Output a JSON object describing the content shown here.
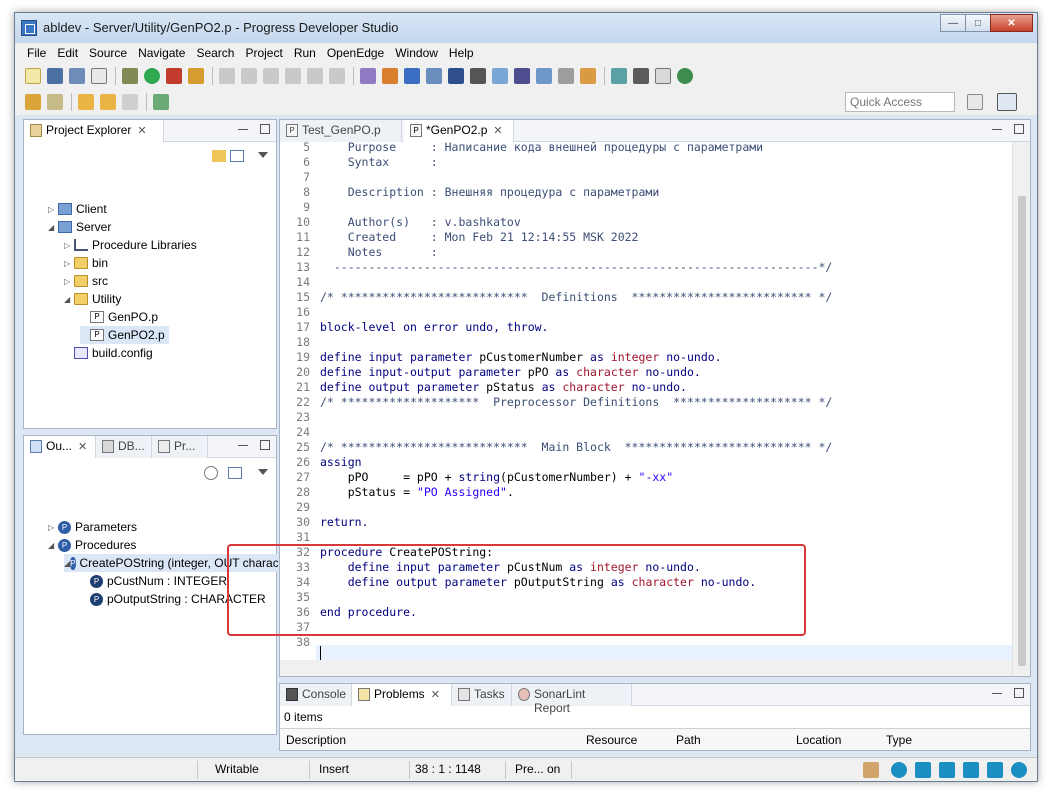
{
  "window": {
    "title": "abldev - Server/Utility/GenPO2.p - Progress Developer Studio"
  },
  "menu": [
    "File",
    "Edit",
    "Source",
    "Navigate",
    "Search",
    "Project",
    "Run",
    "OpenEdge",
    "Window",
    "Help"
  ],
  "toolbar": {
    "quick_access_placeholder": "Quick Access"
  },
  "project_explorer": {
    "title": "Project Explorer",
    "items": [
      {
        "label": "Client"
      },
      {
        "label": "Server"
      },
      {
        "label": "Procedure Libraries"
      },
      {
        "label": "bin"
      },
      {
        "label": "src"
      },
      {
        "label": "Utility"
      },
      {
        "label": "GenPO.p"
      },
      {
        "label": "GenPO2.p"
      },
      {
        "label": "build.config"
      }
    ]
  },
  "outline": {
    "tabs": [
      "Ou...",
      "DB...",
      "Pr..."
    ],
    "items": [
      {
        "label": "Parameters"
      },
      {
        "label": "Procedures"
      },
      {
        "label": "CreatePOString (integer, OUT charac"
      },
      {
        "label": "pCustNum : INTEGER"
      },
      {
        "label": "pOutputString : CHARACTER"
      }
    ]
  },
  "editor": {
    "tabs": [
      {
        "label": "Test_GenPO.p",
        "active": false
      },
      {
        "label": "*GenPO2.p",
        "active": true
      }
    ],
    "lines": [
      {
        "n": "5",
        "text": "    Purpose     : Написание кода внешней процедуры с параметрами",
        "cls": "cm",
        "partial": true
      },
      {
        "n": "6",
        "text": "    Syntax      :",
        "cls": "cm"
      },
      {
        "n": "7",
        "text": "",
        "cls": ""
      },
      {
        "n": "8",
        "text": "    Description : Внешняя процедура с параметрами",
        "cls": "cm"
      },
      {
        "n": "9",
        "text": "",
        "cls": ""
      },
      {
        "n": "10",
        "text": "    Author(s)   : v.bashkatov",
        "cls": "cm"
      },
      {
        "n": "11",
        "text": "    Created     : Mon Feb 21 12:14:55 MSK 2022",
        "cls": "cm"
      },
      {
        "n": "12",
        "text": "    Notes       :",
        "cls": "cm"
      },
      {
        "n": "13",
        "text": "  ----------------------------------------------------------------------*/",
        "cls": "cm"
      },
      {
        "n": "14",
        "text": "",
        "cls": ""
      },
      {
        "n": "15",
        "text": "/* ***************************  Definitions  ************************** */",
        "cls": "cm"
      },
      {
        "n": "16",
        "text": "",
        "cls": ""
      },
      {
        "n": "17",
        "text": "block-level on error undo, throw.",
        "cls": "kwb"
      },
      {
        "n": "18",
        "text": "",
        "cls": ""
      },
      {
        "n": "19",
        "segs": [
          [
            "define input parameter ",
            "kwb"
          ],
          [
            "pCustomerNumber ",
            ""
          ],
          [
            "as ",
            "kwb"
          ],
          [
            "integer ",
            "ty"
          ],
          [
            "no-undo.",
            "kwb"
          ]
        ]
      },
      {
        "n": "20",
        "segs": [
          [
            "define input-output parameter ",
            "kwb"
          ],
          [
            "pPO ",
            ""
          ],
          [
            "as ",
            "kwb"
          ],
          [
            "character ",
            "ty"
          ],
          [
            "no-undo.",
            "kwb"
          ]
        ]
      },
      {
        "n": "21",
        "segs": [
          [
            "define output parameter ",
            "kwb"
          ],
          [
            "pStatus ",
            ""
          ],
          [
            "as ",
            "kwb"
          ],
          [
            "character ",
            "ty"
          ],
          [
            "no-undo.",
            "kwb"
          ]
        ]
      },
      {
        "n": "22",
        "text": "/* ********************  Preprocessor Definitions  ******************** */",
        "cls": "cm"
      },
      {
        "n": "23",
        "text": "",
        "cls": ""
      },
      {
        "n": "24",
        "text": "",
        "cls": ""
      },
      {
        "n": "25",
        "text": "/* ***************************  Main Block  *************************** */",
        "cls": "cm"
      },
      {
        "n": "26",
        "text": "assign",
        "cls": "kwb"
      },
      {
        "n": "27",
        "segs": [
          [
            "    pPO     = pPO + ",
            ""
          ],
          [
            "string",
            "kwb"
          ],
          [
            "(pCustomerNumber) + ",
            ""
          ],
          [
            "\"-xx\"",
            "str"
          ]
        ]
      },
      {
        "n": "28",
        "segs": [
          [
            "    pStatus = ",
            ""
          ],
          [
            "\"PO Assigned\"",
            "str"
          ],
          [
            ".",
            ""
          ]
        ]
      },
      {
        "n": "29",
        "text": "",
        "cls": ""
      },
      {
        "n": "30",
        "text": "return.",
        "cls": "kwb"
      },
      {
        "n": "31",
        "text": "",
        "cls": ""
      },
      {
        "n": "32",
        "segs": [
          [
            "procedure ",
            "kwb"
          ],
          [
            "CreatePOString:",
            ""
          ]
        ]
      },
      {
        "n": "33",
        "segs": [
          [
            "    define input parameter ",
            "kwb"
          ],
          [
            "pCustNum ",
            ""
          ],
          [
            "as ",
            "kwb"
          ],
          [
            "integer ",
            "ty"
          ],
          [
            "no-undo.",
            "kwb"
          ]
        ]
      },
      {
        "n": "34",
        "segs": [
          [
            "    define output parameter ",
            "kwb"
          ],
          [
            "pOutputString ",
            ""
          ],
          [
            "as ",
            "kwb"
          ],
          [
            "character ",
            "ty"
          ],
          [
            "no-undo.",
            "kwb"
          ]
        ]
      },
      {
        "n": "35",
        "text": "",
        "cls": ""
      },
      {
        "n": "36",
        "text": "end procedure.",
        "cls": "kwb"
      },
      {
        "n": "37",
        "text": "",
        "cls": ""
      },
      {
        "n": "38",
        "text": "",
        "cls": ""
      }
    ]
  },
  "bottom_panel": {
    "tabs": [
      "Console",
      "Problems",
      "Tasks",
      "SonarLint Report"
    ],
    "summary": "0 items",
    "columns": [
      "Description",
      "Resource",
      "Path",
      "Location",
      "Type"
    ]
  },
  "status": {
    "mode": "Writable",
    "insert": "Insert",
    "position": "38 : 1 : 1148",
    "progress": "Pre... on"
  }
}
